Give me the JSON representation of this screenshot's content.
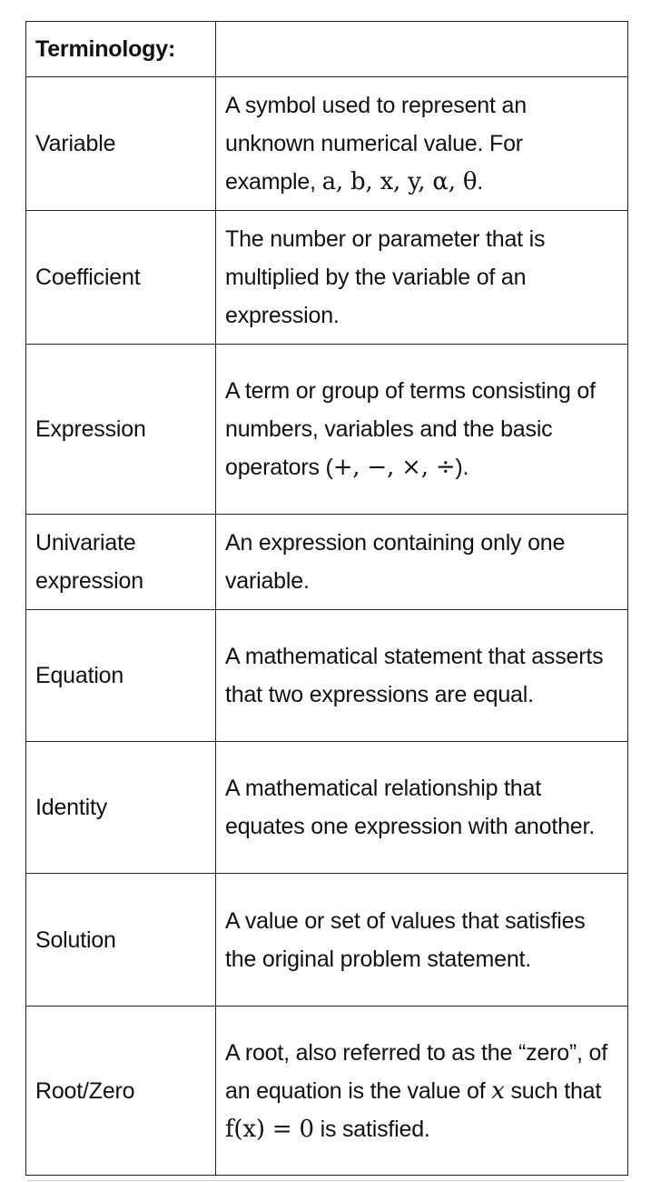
{
  "header": {
    "term_label": "Terminology:",
    "definition_label": ""
  },
  "rows": [
    {
      "term": "Variable",
      "definition": {
        "text": "A symbol used to represent an unknown numerical value. For example, ",
        "math": "a, b, x, y, α, θ",
        "after": "."
      }
    },
    {
      "term": "Coefficient",
      "definition": {
        "text": "The number or parameter that is multiplied by the variable of an expression."
      }
    },
    {
      "term": "Expression",
      "definition": {
        "text": "A term or group of terms consisting of numbers, variables and the basic operators (",
        "math": "+, −, ×, ÷",
        "after": ")."
      }
    },
    {
      "term": "Univariate expression",
      "definition": {
        "text": "An expression containing only one variable."
      }
    },
    {
      "term": "Equation",
      "definition": {
        "text": "A mathematical statement that asserts that two expressions are equal."
      }
    },
    {
      "term": "Identity",
      "definition": {
        "text": "A mathematical relationship that equates one expression with another."
      }
    },
    {
      "term": "Solution",
      "definition": {
        "text": "A value or set of values that satisfies the original problem statement."
      }
    },
    {
      "term": "Root/Zero",
      "definition": {
        "text": "A root, also referred to as the “zero”, of an equation is the value of ",
        "math": "x",
        "middle": " such that ",
        "math2": "f(x) = 0",
        "after": " is satisfied."
      }
    }
  ]
}
